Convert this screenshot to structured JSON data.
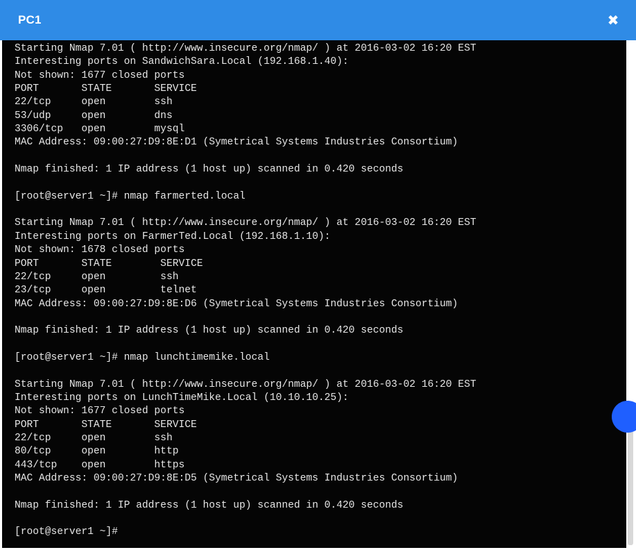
{
  "window": {
    "title": "PC1",
    "close_icon": "close-icon"
  },
  "terminal": {
    "lines": [
      "Starting Nmap 7.01 ( http://www.insecure.org/nmap/ ) at 2016-03-02 16:20 EST",
      "Interesting ports on SandwichSara.Local (192.168.1.40):",
      "Not shown: 1677 closed ports",
      "PORT       STATE       SERVICE",
      "22/tcp     open        ssh",
      "53/udp     open        dns",
      "3306/tcp   open        mysql",
      "MAC Address: 09:00:27:D9:8E:D1 (Symetrical Systems Industries Consortium)",
      "",
      "Nmap finished: 1 IP address (1 host up) scanned in 0.420 seconds",
      "",
      "[root@server1 ~]# nmap farmerted.local",
      "",
      "Starting Nmap 7.01 ( http://www.insecure.org/nmap/ ) at 2016-03-02 16:20 EST",
      "Interesting ports on FarmerTed.Local (192.168.1.10):",
      "Not shown: 1678 closed ports",
      "PORT       STATE        SERVICE",
      "22/tcp     open         ssh",
      "23/tcp     open         telnet",
      "MAC Address: 09:00:27:D9:8E:D6 (Symetrical Systems Industries Consortium)",
      "",
      "Nmap finished: 1 IP address (1 host up) scanned in 0.420 seconds",
      "",
      "[root@server1 ~]# nmap lunchtimemike.local",
      "",
      "Starting Nmap 7.01 ( http://www.insecure.org/nmap/ ) at 2016-03-02 16:20 EST",
      "Interesting ports on LunchTimeMike.Local (10.10.10.25):",
      "Not shown: 1677 closed ports",
      "PORT       STATE       SERVICE",
      "22/tcp     open        ssh",
      "80/tcp     open        http",
      "443/tcp    open        https",
      "MAC Address: 09:00:27:D9:8E:D5 (Symetrical Systems Industries Consortium)",
      "",
      "Nmap finished: 1 IP address (1 host up) scanned in 0.420 seconds",
      "",
      "[root@server1 ~]#"
    ]
  },
  "colors": {
    "titlebar": "#2f8be6",
    "terminal_bg": "#050505",
    "terminal_text": "#e6e6e6",
    "floating_dot": "#1f5fff"
  }
}
